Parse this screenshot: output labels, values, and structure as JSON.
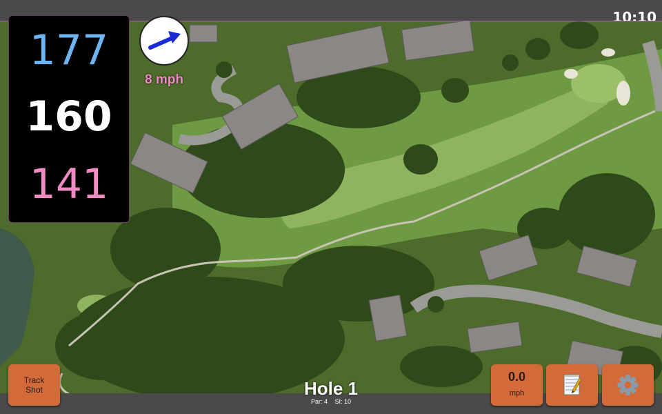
{
  "status_bar": {
    "clock": "10:10"
  },
  "distances": {
    "back": "177",
    "middle": "160",
    "front": "141"
  },
  "wind": {
    "speed_label": "8 mph",
    "direction_icon": "wind-arrow-icon"
  },
  "hole": {
    "title": "Hole 1",
    "par": "Par: 4",
    "stroke_index": "SI: 10"
  },
  "buttons": {
    "track_shot_line1": "Track",
    "track_shot_line2": "Shot",
    "speed_value": "0.0",
    "speed_unit": "mph",
    "notes_icon": "notepad-icon",
    "settings_icon": "gear-icon"
  },
  "colors": {
    "back_distance": "#6cb4f2",
    "middle_distance": "#ffffff",
    "front_distance": "#f08cc4",
    "wind_label": "#f08cc4",
    "button_orange": "#d26a3a",
    "wind_arrow": "#1a2bd6"
  }
}
